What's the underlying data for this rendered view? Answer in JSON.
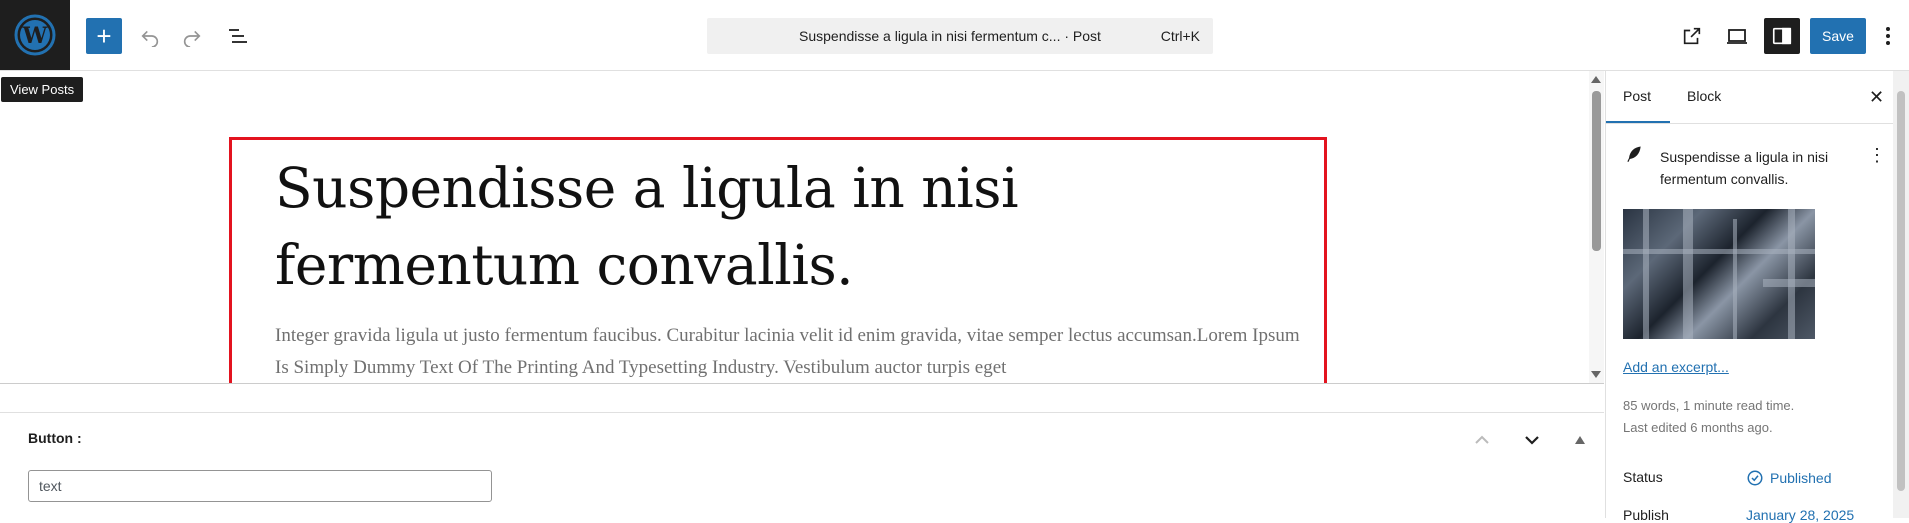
{
  "tooltip": "View Posts",
  "command_bar": {
    "title": "Suspendisse a ligula in nisi fermentum c... · Post",
    "shortcut": "Ctrl+K"
  },
  "toolbar": {
    "save_label": "Save"
  },
  "post": {
    "title": "Suspendisse a ligula in nisi fermentum convallis.",
    "excerpt": "Integer gravida ligula ut justo fermentum faucibus. Curabitur lacinia velit id enim gravida, vitae semper lectus accumsan.Lorem Ipsum Is Simply Dummy Text Of The Printing And Typesetting Industry. Vestibulum auctor turpis eget"
  },
  "meta_box": {
    "label": "Button :",
    "input_value": "text"
  },
  "sidebar": {
    "tabs": [
      "Post",
      "Block"
    ],
    "active_tab": "Post",
    "post_title": "Suspendisse a ligula in nisi fermentum convallis.",
    "excerpt_link": "Add an excerpt...",
    "stats_line1": "85 words, 1 minute read time.",
    "stats_line2": "Last edited 6 months ago.",
    "status_label": "Status",
    "status_value": "Published",
    "publish_label": "Publish",
    "publish_value": "January 28, 2025"
  },
  "icons": [
    "wordpress-logo-icon",
    "plus-icon",
    "undo-icon",
    "redo-icon",
    "document-overview-icon",
    "external-link-icon",
    "desktop-preview-icon",
    "settings-panel-icon",
    "options-icon",
    "close-icon",
    "post-feather-icon",
    "more-options-icon",
    "published-check-icon",
    "chevron-up-icon",
    "chevron-down-icon",
    "collapse-triangle-icon"
  ],
  "colors": {
    "accent": "#2271b1",
    "highlight": "#e3131f",
    "dark": "#1e1e1e"
  }
}
